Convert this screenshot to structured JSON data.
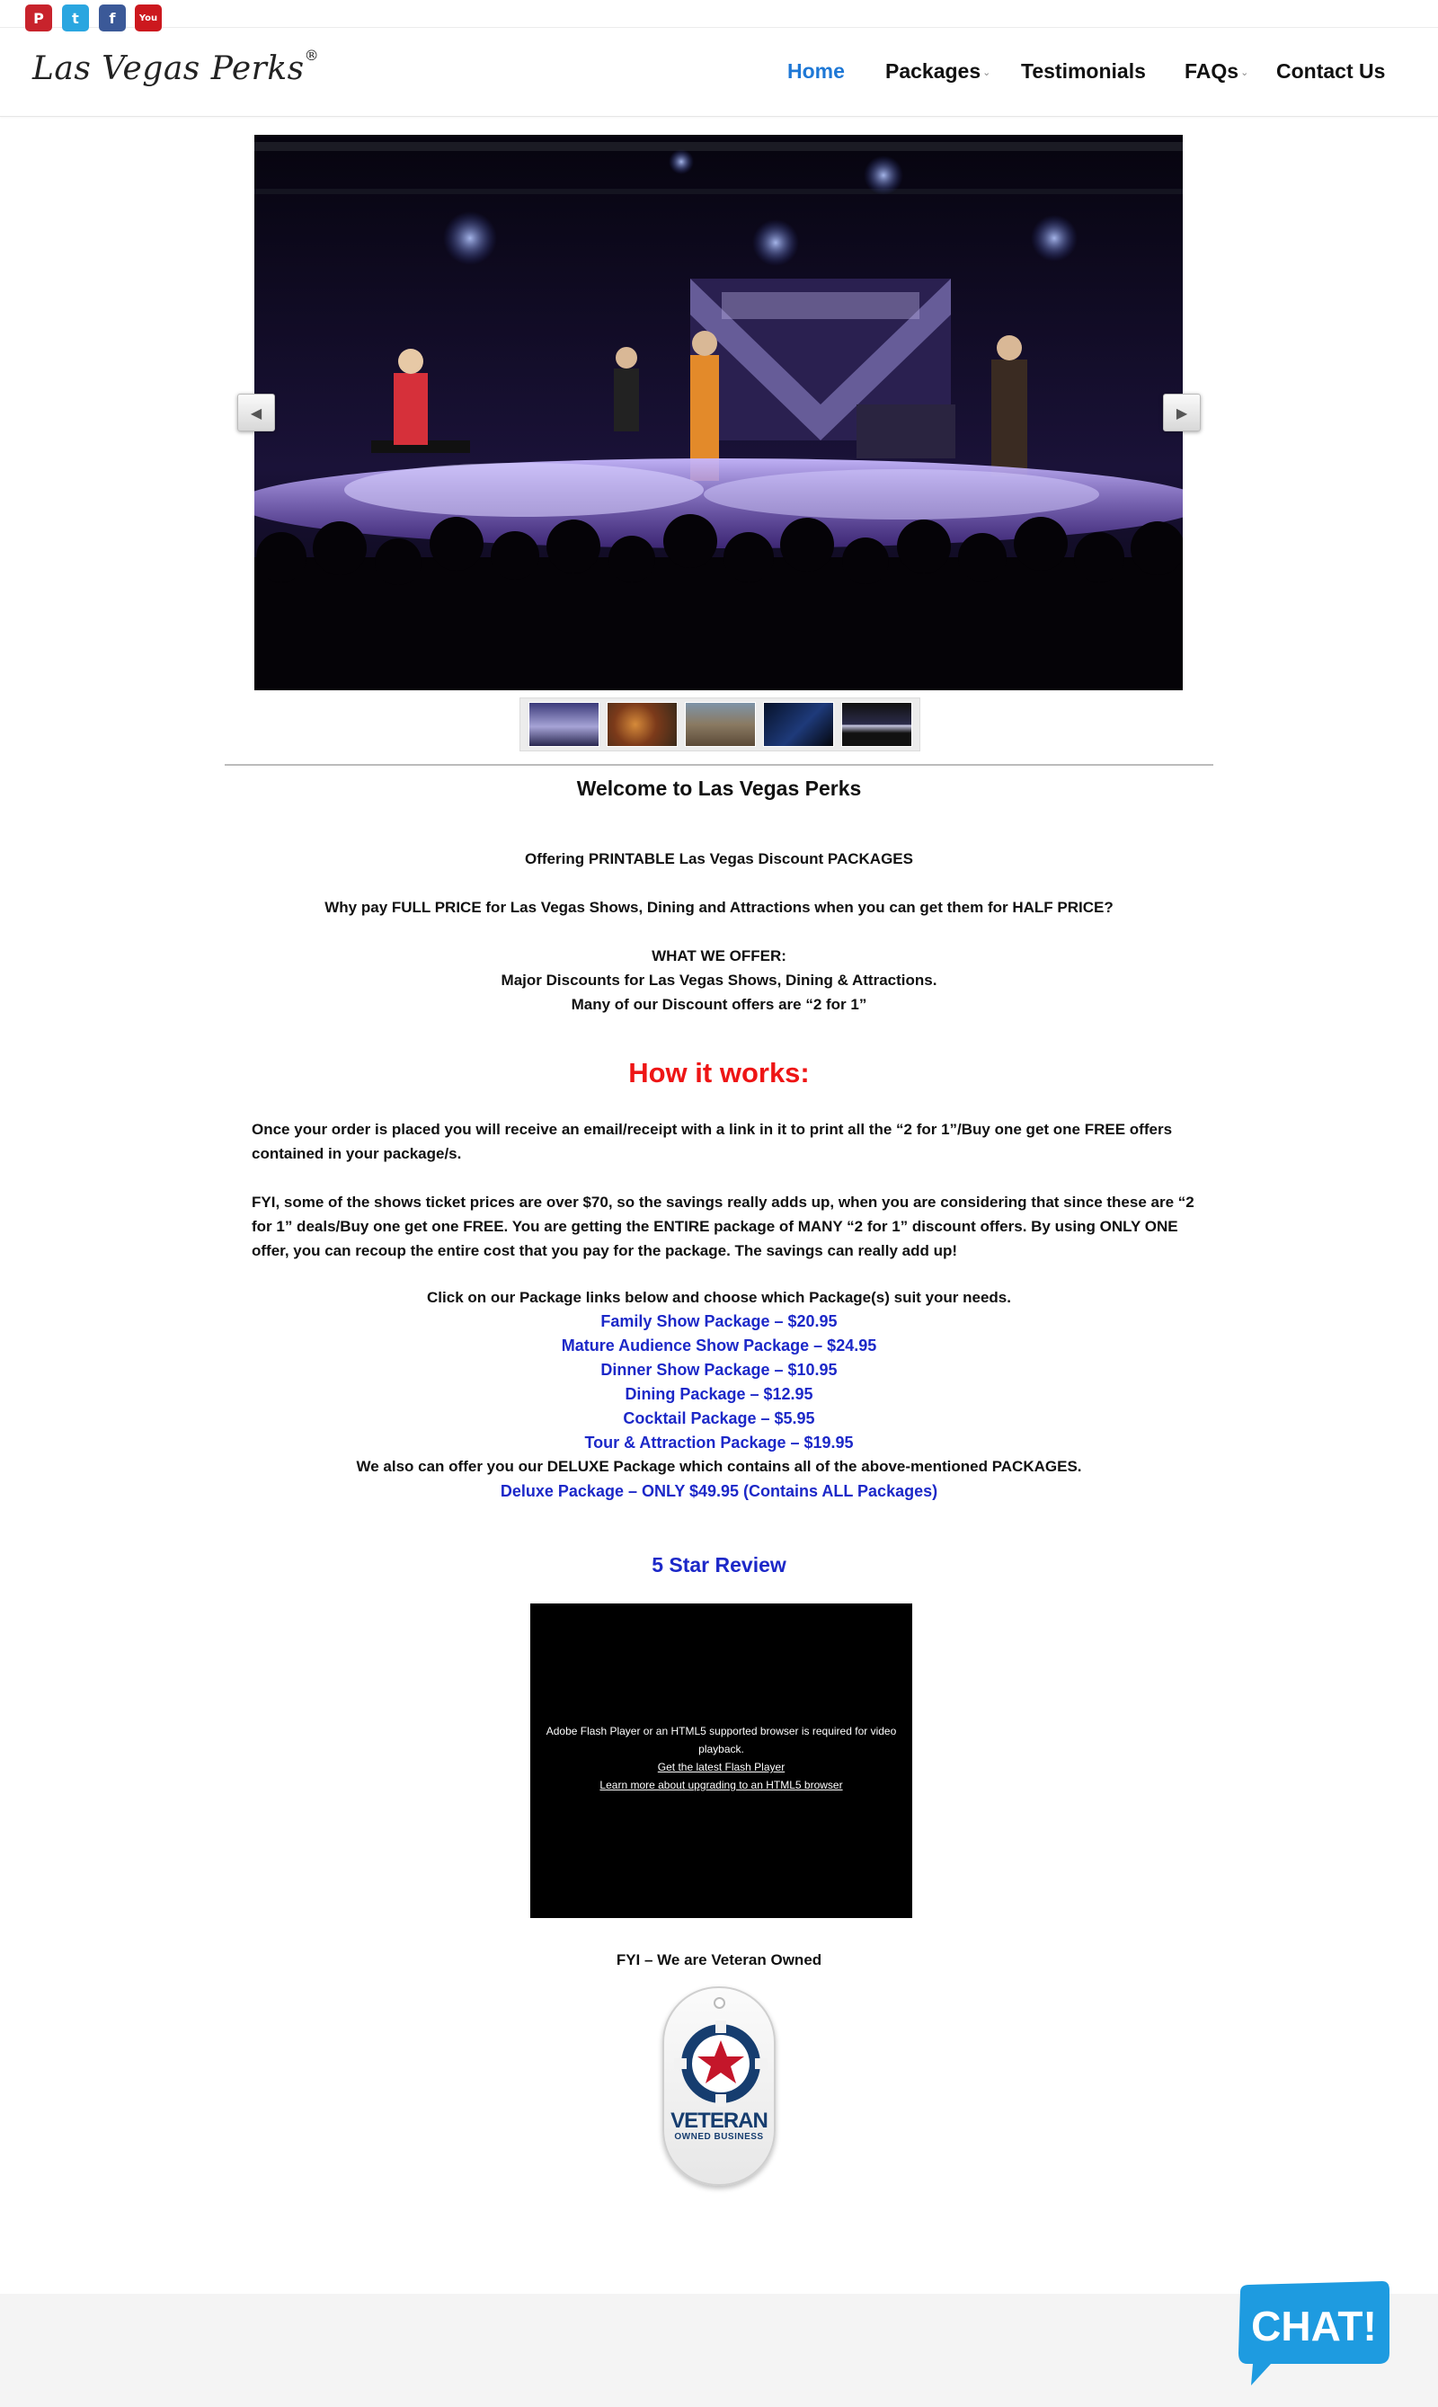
{
  "social": {
    "items": [
      {
        "name": "pinterest-icon",
        "glyph": "P",
        "color": "#c8232c"
      },
      {
        "name": "twitter-icon",
        "glyph": "t",
        "color": "#2aa6e0"
      },
      {
        "name": "facebook-icon",
        "glyph": "f",
        "color": "#3b5998"
      },
      {
        "name": "youtube-icon",
        "glyph": "You",
        "color": "#cc181e"
      }
    ]
  },
  "header": {
    "logo_text": "Las Vegas Perks",
    "logo_mark": "®",
    "nav": {
      "home": "Home",
      "packages": "Packages",
      "testimonials": "Testimonials",
      "faqs": "FAQs",
      "contact": "Contact Us"
    },
    "active_color": "#1e78d6"
  },
  "slider": {
    "prev_icon": "◀",
    "next_icon": "▶",
    "thumbnail_count": 5
  },
  "content": {
    "welcome": "Welcome to Las Vegas Perks",
    "offering": "Offering PRINTABLE Las Vegas Discount PACKAGES",
    "why_pay": "Why pay FULL PRICE for Las Vegas Shows, Dining and Attractions when you can get them for HALF PRICE?",
    "what_we_offer": "WHAT WE OFFER:",
    "major_discounts": "Major Discounts  for Las Vegas Shows, Dining & Attractions.",
    "many_offers": "Many of our Discount offers are “2 for 1”",
    "how_it_works": "How it works:",
    "para1": "Once your order is placed you will receive an email/receipt with a link in it to print all the “2 for 1”/Buy one get one FREE offers contained in your package/s.",
    "para2": "FYI, some of the shows ticket prices are over $70, so the savings really adds up, when you are considering that since these are  “2 for 1” deals/Buy one get one FREE. You are getting the ENTIRE package of MANY “2 for 1” discount offers.  By using ONLY ONE offer, you can recoup the entire cost that you pay for the package.  The savings can really add up!",
    "click_on": "Click on our Package links below and choose which Package(s) suit your needs.",
    "packages": [
      "Family Show Package – $20.95",
      "Mature Audience Show Package – $24.95",
      "Dinner Show Package – $10.95",
      "Dining Package – $12.95",
      "Cocktail Package – $5.95",
      "Tour & Attraction Package – $19.95"
    ],
    "deluxe_intro": "We also can offer you our DELUXE Package which contains all of the above-mentioned PACKAGES.",
    "deluxe_link": "Deluxe Package – ONLY $49.95 (Contains ALL Packages)",
    "review_title": "5 Star Review",
    "link_color": "#1c28c8",
    "heading_red": "#ee1515"
  },
  "video": {
    "message_line1": "Adobe Flash Player or an HTML5 supported browser is required for video playback.",
    "link1": "Get the latest Flash Player",
    "link2": "Learn more about upgrading to an HTML5 browser"
  },
  "veteran": {
    "label": "FYI – We are Veteran Owned",
    "badge_main": "VETERAN",
    "badge_sub": "OWNED BUSINESS"
  },
  "chat": {
    "label": "CHAT!",
    "color": "#1e9be0"
  }
}
